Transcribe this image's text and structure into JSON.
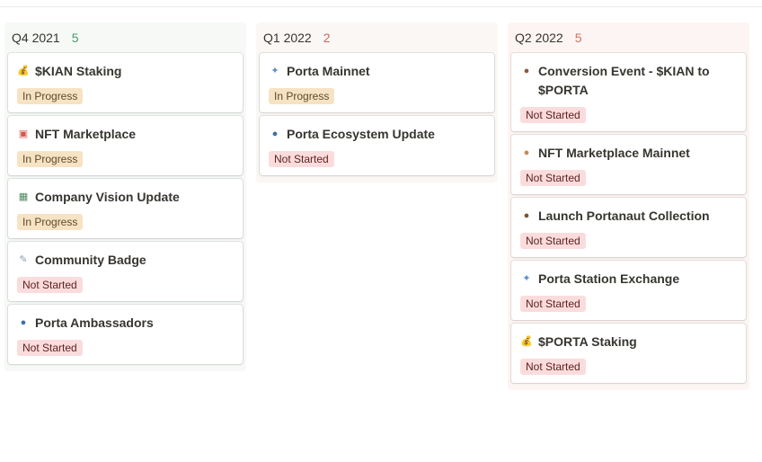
{
  "columns": [
    {
      "title": "Q4 2021",
      "count": "5",
      "bg": "#f6f9f6",
      "count_color": "#4f9a6d",
      "cards": [
        {
          "icon": "money-bag-icon",
          "glyph": "💰",
          "icon_color": "#c99a3a",
          "title": "$KIAN Staking",
          "status": "In Progress"
        },
        {
          "icon": "framed-picture-icon",
          "glyph": "▣",
          "icon_color": "#d8584d",
          "title": "NFT Marketplace",
          "status": "In Progress"
        },
        {
          "icon": "landscape-picture-icon",
          "glyph": "▦",
          "icon_color": "#4f8a5f",
          "title": "Company Vision Update",
          "status": "In Progress"
        },
        {
          "icon": "syringe-icon",
          "glyph": "✎",
          "icon_color": "#8aa0b5",
          "title": "Community Badge",
          "status": "Not Started"
        },
        {
          "icon": "people-icon",
          "glyph": "●",
          "icon_color": "#3f6fa3",
          "title": "Porta Ambassadors",
          "status": "Not Started"
        }
      ]
    },
    {
      "title": "Q1 2022",
      "count": "2",
      "bg": "#faf7f5",
      "count_color": "#c56a5a",
      "cards": [
        {
          "icon": "sparkles-icon",
          "glyph": "✦",
          "icon_color": "#5a8fd0",
          "title": "Porta Mainnet",
          "status": "In Progress"
        },
        {
          "icon": "people-icon",
          "glyph": "●",
          "icon_color": "#3f6fa3",
          "title": "Porta Ecosystem Update",
          "status": "Not Started"
        }
      ]
    },
    {
      "title": "Q2 2022",
      "count": "5",
      "bg": "#fdf5f3",
      "count_color": "#d07060",
      "cards": [
        {
          "icon": "person-icon",
          "glyph": "●",
          "icon_color": "#8a5a3c",
          "title": "Conversion Event - $KIAN to $PORTA",
          "status": "Not Started"
        },
        {
          "icon": "monkey-face-icon",
          "glyph": "●",
          "icon_color": "#c58a5a",
          "title": "NFT Marketplace Mainnet",
          "status": "Not Started"
        },
        {
          "icon": "astronaut-icon",
          "glyph": "●",
          "icon_color": "#7a5236",
          "title": "Launch Portanaut Collection",
          "status": "Not Started"
        },
        {
          "icon": "sparkles-icon",
          "glyph": "✦",
          "icon_color": "#5a8fd0",
          "title": "Porta Station Exchange",
          "status": "Not Started"
        },
        {
          "icon": "money-bag-icon",
          "glyph": "💰",
          "icon_color": "#c99a3a",
          "title": "$PORTA Staking",
          "status": "Not Started"
        }
      ]
    }
  ]
}
